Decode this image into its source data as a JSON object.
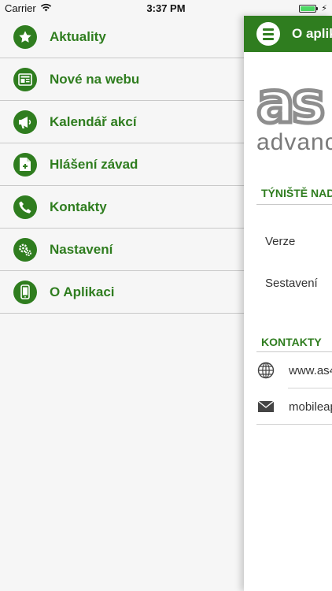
{
  "status_bar": {
    "carrier": "Carrier",
    "time": "3:37 PM"
  },
  "menu": {
    "items": [
      {
        "label": "Aktuality",
        "icon": "star-icon"
      },
      {
        "label": "Nové na webu",
        "icon": "newspaper-icon"
      },
      {
        "label": "Kalendář akcí",
        "icon": "megaphone-icon"
      },
      {
        "label": "Hlášení závad",
        "icon": "report-document-icon"
      },
      {
        "label": "Kontakty",
        "icon": "phone-icon"
      },
      {
        "label": "Nastavení",
        "icon": "gears-icon"
      },
      {
        "label": "O Aplikaci",
        "icon": "smartphone-icon"
      }
    ]
  },
  "navbar": {
    "title": "O aplik"
  },
  "logo": {
    "main": "as",
    "sub": "advanc"
  },
  "about": {
    "section_title": "TÝNIŠTĚ NAD",
    "version_label": "Verze",
    "build_label": "Sestavení"
  },
  "contacts": {
    "section_title": "KONTAKTY",
    "web": "www.as4",
    "email": "mobileap"
  },
  "colors": {
    "accent": "#2f7d1f",
    "divider": "#c9c9c9",
    "background": "#f6f6f6"
  }
}
